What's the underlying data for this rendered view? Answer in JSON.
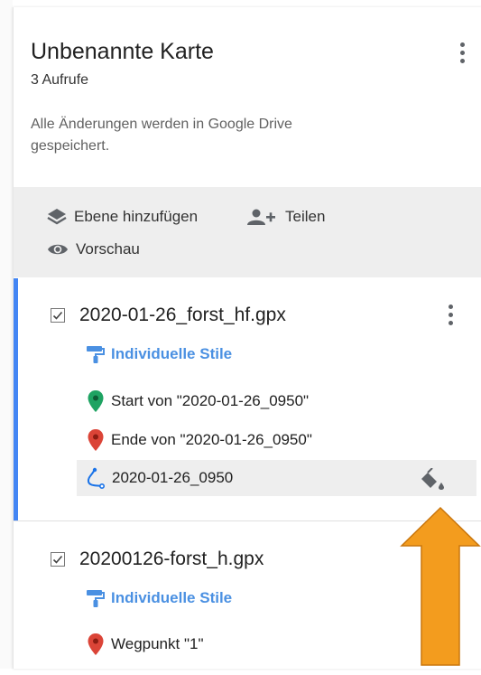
{
  "map": {
    "title": "Unbenannte Karte",
    "views": "3 Aufrufe",
    "saved_status": "Alle Änderungen werden in Google Drive gespeichert."
  },
  "toolbar": {
    "add_layer": "Ebene hinzufügen",
    "share": "Teilen",
    "preview": "Vorschau"
  },
  "layers": [
    {
      "name": "2020-01-26_forst_hf.gpx",
      "checked": true,
      "style_label": "Individuelle Stile",
      "features": [
        {
          "label": "Start von \"2020-01-26_0950\"",
          "icon": "green-marker-icon",
          "color": "#1ea362"
        },
        {
          "label": "Ende von \"2020-01-26_0950\"",
          "icon": "red-marker-icon",
          "color": "#db4437"
        },
        {
          "label": "2020-01-26_0950",
          "icon": "route-line-icon",
          "color": "#1a73e8",
          "selected": true
        }
      ]
    },
    {
      "name": "20200126-forst_h.gpx",
      "checked": true,
      "style_label": "Individuelle Stile",
      "features": [
        {
          "label": "Wegpunkt \"1\"",
          "icon": "red-marker-icon",
          "color": "#db4437"
        }
      ]
    }
  ],
  "colors": {
    "accent": "#4285f4",
    "style_link": "#4a90e2",
    "toolbar_bg": "#eeeeee",
    "arrow": "#f39c1e"
  }
}
